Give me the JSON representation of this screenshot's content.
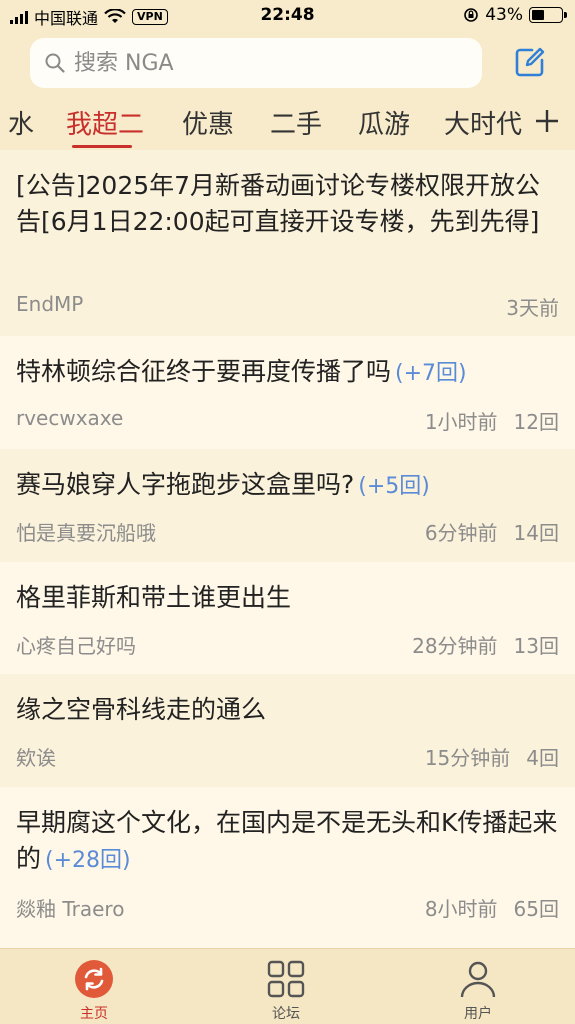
{
  "status_bar": {
    "carrier": "中国联通",
    "vpn": "VPN",
    "time": "22:48",
    "battery_text": "43%",
    "battery_level": 0.43
  },
  "header": {
    "search_placeholder": "搜索 NGA",
    "compose_icon": "compose-icon",
    "tabs": [
      {
        "label": "水"
      },
      {
        "label": "我超二",
        "active": true
      },
      {
        "label": "优惠"
      },
      {
        "label": "二手"
      },
      {
        "label": "瓜游"
      },
      {
        "label": "大时代"
      }
    ],
    "add_icon": "plus-icon"
  },
  "posts": [
    {
      "title": "[公告]2025年7月新番动画讨论专楼权限开放公告[6月1日22:00起可直接开设专楼，先到先得]",
      "reply_inc": "",
      "author": "EndMP",
      "time": "3天前",
      "replies": ""
    },
    {
      "title": "特林顿综合征终于要再度传播了吗",
      "reply_inc": "(+7回)",
      "author": "rvecwxaxe",
      "time": "1小时前",
      "replies": "12回"
    },
    {
      "title": "赛马娘穿人字拖跑步这盒里吗?",
      "reply_inc": "(+5回)",
      "author": "怕是真要沉船哦",
      "time": "6分钟前",
      "replies": "14回"
    },
    {
      "title": "格里菲斯和带土谁更出生",
      "reply_inc": "",
      "author": "心疼自己好吗",
      "time": "28分钟前",
      "replies": "13回"
    },
    {
      "title": "缘之空骨科线走的通么",
      "reply_inc": "",
      "author": "欸诶",
      "time": "15分钟前",
      "replies": "4回"
    },
    {
      "title": "早期腐这个文化，在国内是不是无头和K传播起来的",
      "reply_inc": "(+28回)",
      "author": "燚釉 Traero",
      "time": "8小时前",
      "replies": "65回"
    }
  ],
  "bottom_nav": [
    {
      "label": "主页",
      "icon": "refresh-icon",
      "active": true
    },
    {
      "label": "论坛",
      "icon": "grid-icon"
    },
    {
      "label": "用户",
      "icon": "user-icon"
    }
  ],
  "colors": {
    "accent": "#C9302C",
    "reply_inc": "#5B8BD6",
    "background": "#FBF2DC"
  }
}
